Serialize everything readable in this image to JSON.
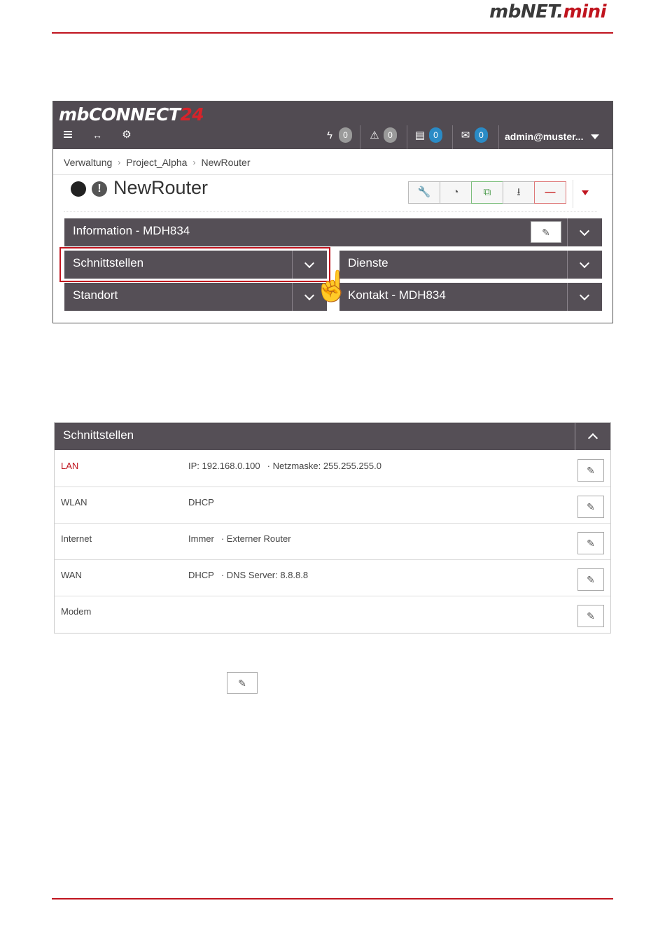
{
  "doc": {
    "logo_main": "mbNET.",
    "logo_accent": "mini"
  },
  "app": {
    "brand_main": "mbCONNECT",
    "brand_accent": "24",
    "badges": {
      "alarms": "0",
      "warnings": "0",
      "servers": "0",
      "messages": "0"
    },
    "user": "admin@muster...",
    "breadcrumb": [
      "Verwaltung",
      "Project_Alpha",
      "NewRouter"
    ],
    "device_title": "NewRouter",
    "status_warn_symbol": "!",
    "panels": {
      "information": "Information - MDH834",
      "interfaces": "Schnittstellen",
      "services": "Dienste",
      "location": "Standort",
      "contact": "Kontakt - MDH834"
    }
  },
  "interfaces": {
    "title": "Schnittstellen",
    "rows": [
      {
        "name": "LAN",
        "value": "IP: 192.168.0.100",
        "extra": "· Netzmaske: 255.255.255.0"
      },
      {
        "name": "WLAN",
        "value": "DHCP",
        "extra": ""
      },
      {
        "name": "Internet",
        "value": "Immer",
        "extra": "· Externer Router"
      },
      {
        "name": "WAN",
        "value": "DHCP",
        "extra": "· DNS Server: 8.8.8.8"
      },
      {
        "name": "Modem",
        "value": "",
        "extra": ""
      }
    ]
  },
  "colors": {
    "accent": "#c0141e",
    "topbar": "#514b52",
    "panel": "#554f56",
    "badge_blue": "#2a8bc6",
    "badge_gray": "#9a9a9a"
  }
}
